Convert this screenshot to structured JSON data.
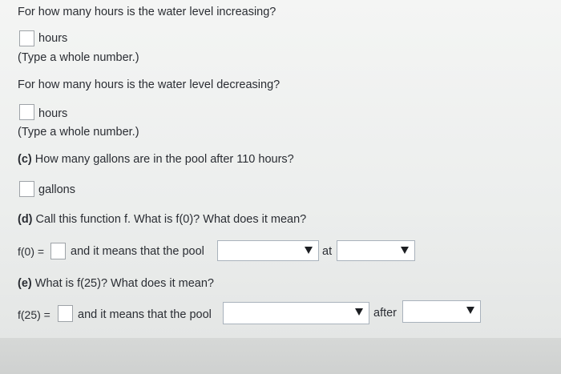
{
  "questions": {
    "increase": {
      "prompt": "For how many hours is the water level increasing?",
      "unit": "hours",
      "hint": "(Type a whole number.)"
    },
    "decrease": {
      "prompt": "For how many hours is the water level decreasing?",
      "unit": "hours",
      "hint": "(Type a whole number.)"
    },
    "c": {
      "label": "(c)",
      "prompt": "How many gallons are in the pool after 110 hours?",
      "unit": "gallons"
    },
    "d": {
      "label": "(d)",
      "prompt": "Call this function f. What is f(0)? What does it mean?",
      "expr": "f(0) =",
      "meaning": "and it means that the pool",
      "connector": "at",
      "select1_value": "",
      "select2_value": ""
    },
    "e": {
      "label": "(e)",
      "prompt": "What is f(25)? What does it mean?",
      "expr": "f(25) =",
      "meaning": "and it means that the pool",
      "connector": "after",
      "select1_value": "",
      "select2_value": ""
    }
  }
}
